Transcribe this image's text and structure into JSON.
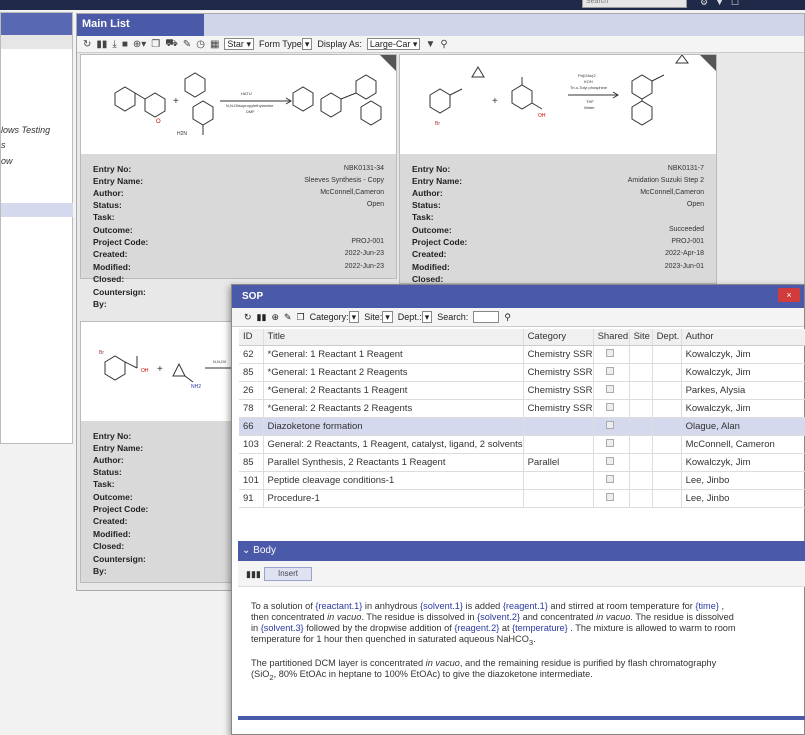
{
  "topbar": {
    "search_placeholder": "Search"
  },
  "left": {
    "items": [
      "lows Testing",
      "s",
      "ow"
    ]
  },
  "main": {
    "tab": "Main List",
    "toolbar": {
      "star": "Star",
      "form_type": "Form Type",
      "display_as": "Display As:",
      "display_value": "Large-Car"
    },
    "cards": [
      {
        "reaction": {
          "above": "HATU",
          "below1": "N,N-Diisopropylethylamine",
          "below2": "DMF"
        },
        "fields": [
          {
            "k": "Entry No:",
            "v": "NBK0131-34"
          },
          {
            "k": "Entry Name:",
            "v": "Sleeves Synthesis - Copy"
          },
          {
            "k": "Author:",
            "v": "McConnell,Cameron"
          },
          {
            "k": "Status:",
            "v": "Open"
          },
          {
            "k": "Task:",
            "v": ""
          },
          {
            "k": "Outcome:",
            "v": ""
          },
          {
            "k": "Project Code:",
            "v": "PROJ-001"
          },
          {
            "k": "Created:",
            "v": "2022-Jun-23"
          },
          {
            "k": "Modified:",
            "v": "2022-Jun-23"
          },
          {
            "k": "Closed:",
            "v": ""
          },
          {
            "k": "Countersign:",
            "v": ""
          },
          {
            "k": "By:",
            "v": ""
          }
        ]
      },
      {
        "reaction": {
          "above": "Pd(OAc)2",
          "below1": "KOH",
          "below2": "Tri-o-Tolyl phosphine",
          "below3": "THF",
          "below4": "Water"
        },
        "fields": [
          {
            "k": "Entry No:",
            "v": "NBK0131-7"
          },
          {
            "k": "Entry Name:",
            "v": "Amidation Suzuki Step 2"
          },
          {
            "k": "Author:",
            "v": "McConnell,Cameron"
          },
          {
            "k": "Status:",
            "v": "Open"
          },
          {
            "k": "Task:",
            "v": ""
          },
          {
            "k": "Outcome:",
            "v": "Succeeded"
          },
          {
            "k": "Project Code:",
            "v": "PROJ-001"
          },
          {
            "k": "Created:",
            "v": "2022-Apr-18"
          },
          {
            "k": "Modified:",
            "v": "2023-Jun-01"
          },
          {
            "k": "Closed:",
            "v": ""
          }
        ]
      },
      {
        "reaction": {
          "above": "N,N-Dii"
        },
        "fields": [
          {
            "k": "Entry No:",
            "v": ""
          },
          {
            "k": "Entry Name:",
            "v": ""
          },
          {
            "k": "Author:",
            "v": ""
          },
          {
            "k": "Status:",
            "v": ""
          },
          {
            "k": "Task:",
            "v": ""
          },
          {
            "k": "Outcome:",
            "v": ""
          },
          {
            "k": "Project Code:",
            "v": ""
          },
          {
            "k": "Created:",
            "v": ""
          },
          {
            "k": "Modified:",
            "v": ""
          },
          {
            "k": "Closed:",
            "v": ""
          },
          {
            "k": "Countersign:",
            "v": ""
          },
          {
            "k": "By:",
            "v": ""
          }
        ]
      }
    ]
  },
  "sop": {
    "title": "SOP",
    "close": "×",
    "toolbar": {
      "category": "Category:",
      "site": "Site:",
      "dept": "Dept.:",
      "search": "Search:"
    },
    "columns": [
      "ID",
      "Title",
      "Category",
      "Shared",
      "Site",
      "Dept.",
      "Author"
    ],
    "rows": [
      {
        "id": "62",
        "title": "*General: 1 Reactant 1 Reagent",
        "category": "Chemistry SSR",
        "author": "Kowalczyk, Jim"
      },
      {
        "id": "85",
        "title": "*General: 1 Reactant 2 Reagents",
        "category": "Chemistry SSR",
        "author": "Kowalczyk, Jim"
      },
      {
        "id": "26",
        "title": "*General: 2 Reactants 1 Reagent",
        "category": "Chemistry SSR",
        "author": "Parkes, Alysia"
      },
      {
        "id": "78",
        "title": "*General: 2 Reactants 2 Reagents",
        "category": "Chemistry SSR",
        "author": "Kowalczyk, Jim"
      },
      {
        "id": "66",
        "title": "Diazoketone formation",
        "category": "",
        "author": "Olague, Alan"
      },
      {
        "id": "103",
        "title": "General: 2 Reactants, 1 Reagent, catalyst, ligand, 2 solvents",
        "category": "",
        "author": "McConnell, Cameron"
      },
      {
        "id": "85",
        "title": "Parallel Synthesis, 2 Reactants 1 Reagent",
        "category": "Parallel",
        "author": "Kowalczyk, Jim"
      },
      {
        "id": "101",
        "title": "Peptide cleavage conditions-1",
        "category": "",
        "author": "Lee, Jinbo"
      },
      {
        "id": "91",
        "title": "Procedure-1",
        "category": "",
        "author": "Lee, Jinbo"
      }
    ],
    "body": {
      "header": "Body",
      "insert": "Insert",
      "p1": {
        "a": "To a solution of ",
        "r1": "{reactant.1}",
        "b": " in anhydrous ",
        "s1": "{solvent.1}",
        "c": "  is added ",
        "g1": "{reagent.1}",
        "d": "  and stirred at room temperature for ",
        "t": "{time}",
        "e": " , then concentrated ",
        "iv1": "in vacuo",
        "f": ". The residue is dissolved in ",
        "s2": "{solvent.2}",
        "g": "  and concentrated ",
        "iv2": "in vacuo",
        "h": ". The residue is dissolved in ",
        "s3": "{solvent.3}",
        "i": " followed by the dropwise addition of ",
        "g2": "{reagent.2}",
        "j": " at ",
        "tp": "{temperature}",
        "k": " . The mixture is allowed to warm to room temperature for 1 hour then quenched in saturated aqueous NaHCO",
        "k_sub": "3",
        "k_end": "."
      },
      "p2": {
        "a": "The partitioned DCM layer is concentrated ",
        "iv": "in vacuo",
        "b": ", and the remaining residue is purified by flash chromatography (SiO",
        "sub": "2",
        "c": ", 80% EtOAc in heptane to 100% EtOAc) to give the diazoketone intermediate."
      }
    }
  }
}
